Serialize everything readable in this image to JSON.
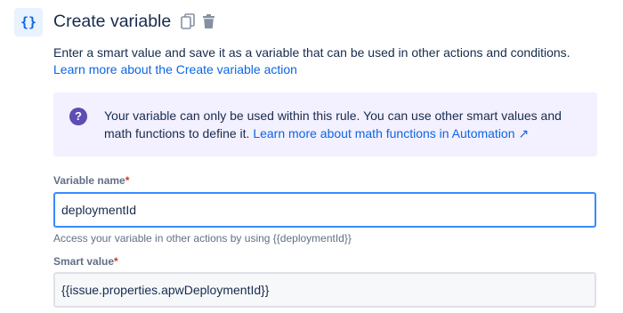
{
  "header": {
    "icon_text": "{}",
    "title": "Create variable",
    "icons": [
      "copy-icon",
      "trash-icon"
    ]
  },
  "description": {
    "text": "Enter a smart value and save it as a variable that can be used in other actions and conditions.",
    "link": "Learn more about the Create variable action"
  },
  "info_panel": {
    "icon": "question-icon",
    "icon_text": "?",
    "text": "Your variable can only be used within this rule. You can use other smart values and math functions to define it.",
    "link": "Learn more about math functions in Automation ↗"
  },
  "fields": {
    "variable_name": {
      "label": "Variable name",
      "required_mark": "*",
      "value": "deploymentId",
      "helper": "Access your variable in other actions by using {{deploymentId}}"
    },
    "smart_value": {
      "label": "Smart value",
      "required_mark": "*",
      "value": "{{issue.properties.apwDeploymentId}}"
    }
  },
  "colors": {
    "accent": "#0c66e4",
    "panel_bg": "#f3f0ff",
    "panel_icon": "#5e4db2",
    "focus_border": "#388bff",
    "required": "#c9372c"
  }
}
